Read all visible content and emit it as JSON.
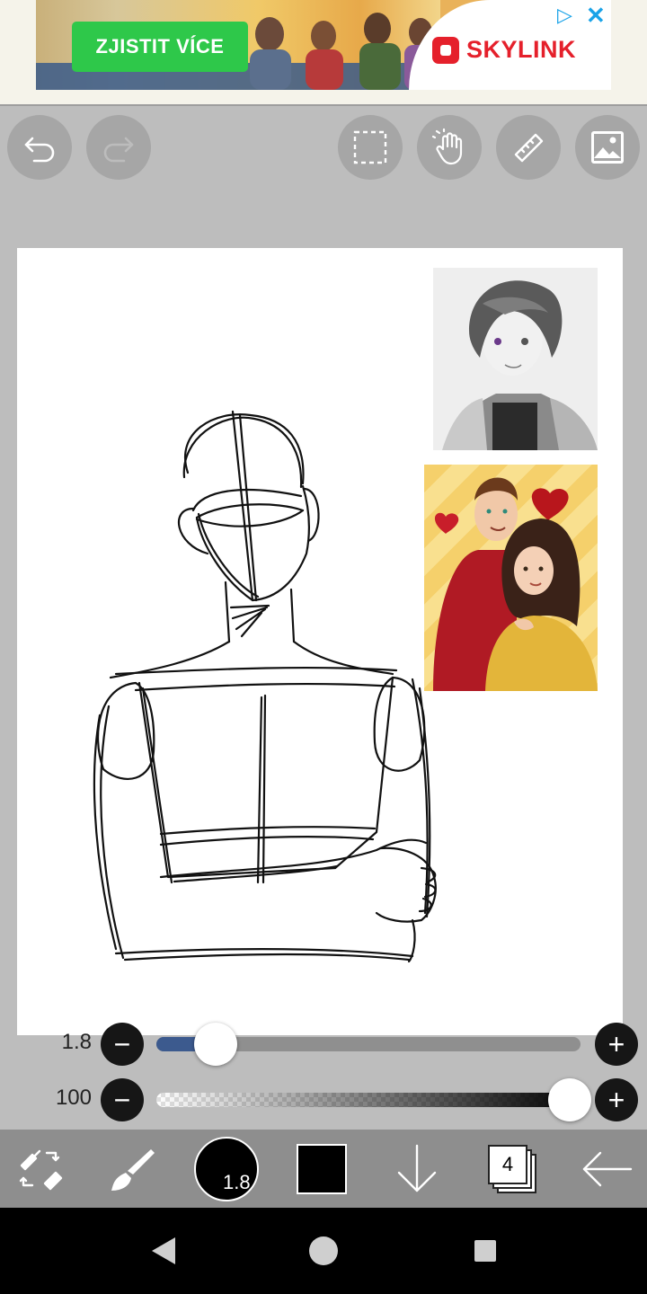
{
  "ad": {
    "cta_label": "ZJISTIT VÍCE",
    "brand": "SKYLINK",
    "adchoices_icon": "adchoices-icon",
    "close_icon": "close-icon"
  },
  "toolbar": {
    "undo_icon": "undo-icon",
    "redo_icon": "redo-icon",
    "select_icon": "selection-icon",
    "hand_icon": "hand-icon",
    "ruler_icon": "ruler-icon",
    "image_icon": "image-icon"
  },
  "sliders": {
    "size": {
      "label": "1.8",
      "value_fraction": 0.07
    },
    "opacity": {
      "label": "100",
      "value_fraction": 1.0
    },
    "minus": "−",
    "plus": "+"
  },
  "bottombar": {
    "brush_size": "1.8",
    "color": "#000000",
    "layer_count": "4"
  },
  "colors": {
    "toolbar_bg": "#bdbdbd",
    "bottombar_bg": "#8e8e8e",
    "slider_fill": "#3c5a8e",
    "ad_cta": "#2ec84a",
    "brand_red": "#e5202b"
  }
}
